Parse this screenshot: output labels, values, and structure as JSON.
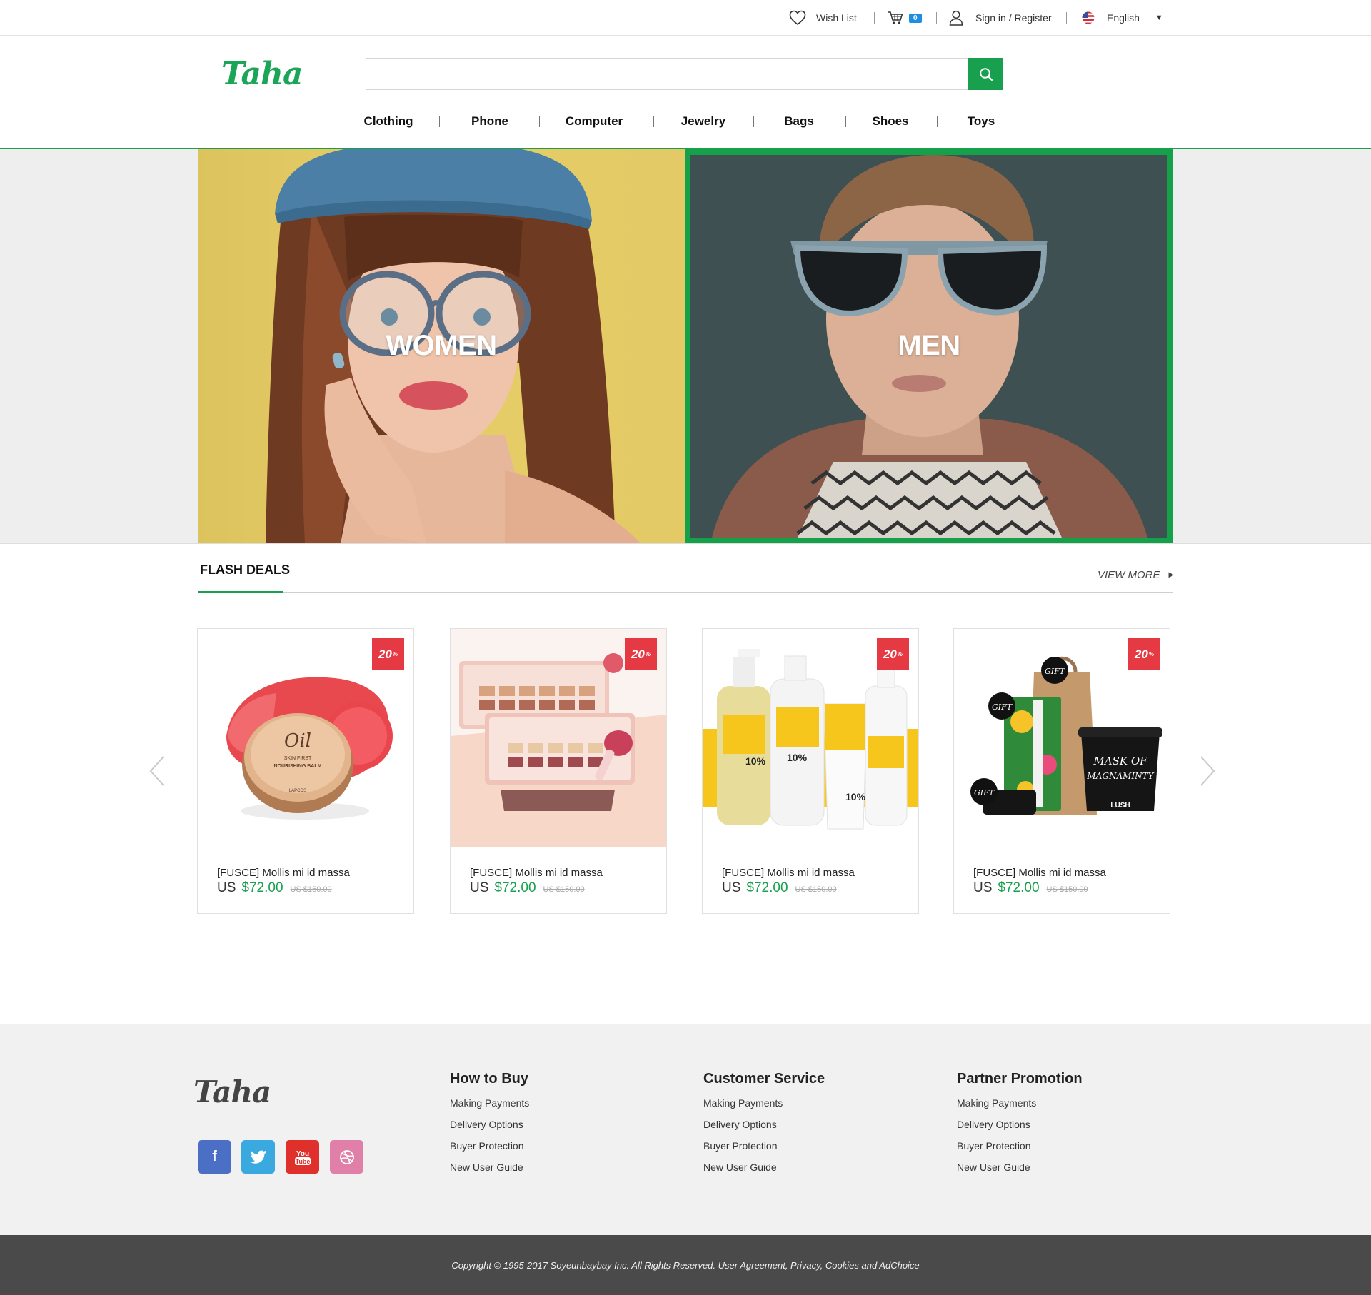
{
  "topbar": {
    "wishlist_label": "Wish List",
    "cart_count": "0",
    "signin_label": "Sign in / Register",
    "language_label": "English"
  },
  "header": {
    "logo_text": "Taha",
    "search_placeholder": "",
    "nav": [
      "Clothing",
      "Phone",
      "Computer",
      "Jewelry",
      "Bags",
      "Shoes",
      "Toys"
    ]
  },
  "hero": {
    "women_label": "WOMEN",
    "men_label": "MEN"
  },
  "flash_deals": {
    "title": "FLASH DEALS",
    "view_more": "VIEW MORE",
    "products": [
      {
        "name": "[FUSCE] Mollis mi id massa",
        "currency": "US",
        "price": "$72.00",
        "old_price": "US $150.00",
        "discount": "20",
        "discount_unit": "%"
      },
      {
        "name": "[FUSCE] Mollis mi id massa",
        "currency": "US",
        "price": "$72.00",
        "old_price": "US $150.00",
        "discount": "20",
        "discount_unit": "%"
      },
      {
        "name": "[FUSCE] Mollis mi id massa",
        "currency": "US",
        "price": "$72.00",
        "old_price": "US $150.00",
        "discount": "20",
        "discount_unit": "%"
      },
      {
        "name": "[FUSCE] Mollis mi id massa",
        "currency": "US",
        "price": "$72.00",
        "old_price": "US $150.00",
        "discount": "20",
        "discount_unit": "%"
      }
    ]
  },
  "footer": {
    "logo_text": "Taha",
    "columns": [
      {
        "title": "How to Buy",
        "links": [
          "Making Payments",
          "Delivery Options",
          "Buyer Protection",
          "New User Guide"
        ]
      },
      {
        "title": "Customer Service",
        "links": [
          "Making Payments",
          "Delivery Options",
          "Buyer Protection",
          "New User Guide"
        ]
      },
      {
        "title": "Partner Promotion",
        "links": [
          "Making Payments",
          "Delivery Options",
          "Buyer Protection",
          "New User Guide"
        ]
      }
    ],
    "social": [
      "facebook-icon",
      "twitter-icon",
      "youtube-icon",
      "dribbble-icon"
    ],
    "copyright": "Copyright © 1995-2017 Soyeunbaybay Inc. All Rights Reserved. User Agreement, Privacy, Cookies and AdChoice"
  },
  "colors": {
    "brand_green": "#19a04f",
    "badge_red": "#e53a43",
    "cart_badge_blue": "#1e8fe0",
    "footer_bg": "#f1f1f1",
    "copyright_bg": "#4a4a4a"
  }
}
